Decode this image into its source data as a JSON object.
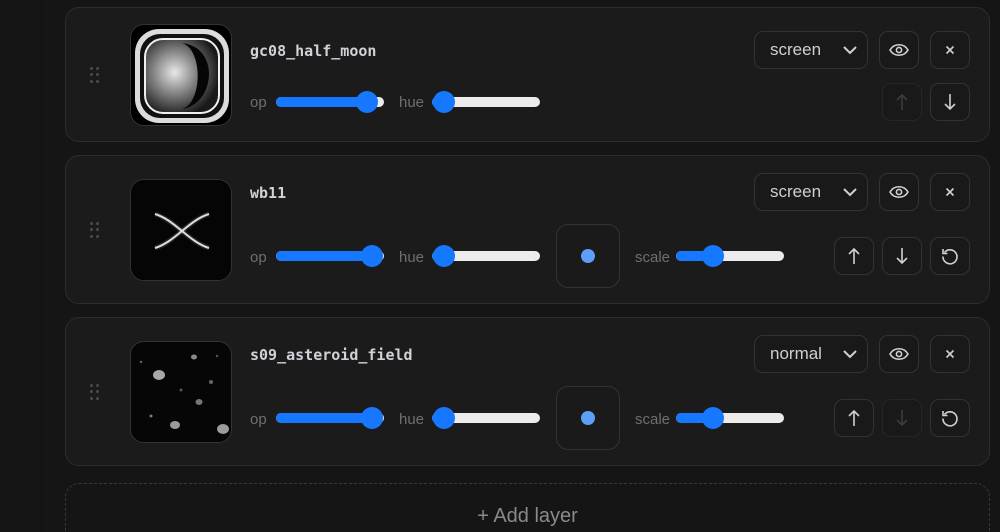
{
  "colors": {
    "accent": "#1677ff",
    "background": "#151515",
    "card": "#1b1b1b"
  },
  "labels": {
    "opacity": "op",
    "hue": "hue",
    "scale": "scale"
  },
  "layers": [
    {
      "name": "gc08_half_moon",
      "thumbnail": "half-moon-glass",
      "blend_mode": "screen",
      "opacity": 0.84,
      "hue": 0.11,
      "has_transform": false,
      "move_up_enabled": false,
      "move_down_enabled": true,
      "reset_shown": false
    },
    {
      "name": "wb11",
      "thumbnail": "crossing-curves",
      "blend_mode": "screen",
      "opacity": 0.89,
      "hue": 0.11,
      "scale": 0.34,
      "has_transform": true,
      "move_up_enabled": true,
      "move_down_enabled": true,
      "reset_shown": true
    },
    {
      "name": "s09_asteroid_field",
      "thumbnail": "asteroid-field",
      "blend_mode": "normal",
      "opacity": 0.89,
      "hue": 0.11,
      "scale": 0.34,
      "has_transform": true,
      "move_up_enabled": true,
      "move_down_enabled": false,
      "reset_shown": true
    }
  ],
  "add_layer_label": "+ Add layer"
}
